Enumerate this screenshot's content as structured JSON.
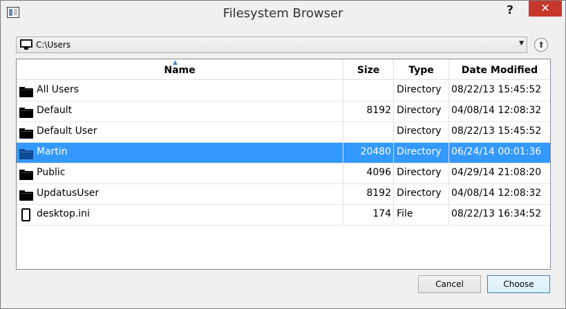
{
  "window": {
    "title": "Filesystem Browser",
    "help_label": "?",
    "close_label": "✕"
  },
  "path": {
    "value": "C:\\Users",
    "icon": "computer-icon"
  },
  "columns": {
    "name": "Name",
    "size": "Size",
    "type": "Type",
    "date": "Date Modified"
  },
  "rows": [
    {
      "name": "All Users",
      "size": "",
      "type": "Directory",
      "date": "08/22/13 15:45:52",
      "icon": "folder-icon",
      "selected": false
    },
    {
      "name": "Default",
      "size": "8192",
      "type": "Directory",
      "date": "04/08/14 12:08:32",
      "icon": "folder-icon",
      "selected": false
    },
    {
      "name": "Default User",
      "size": "",
      "type": "Directory",
      "date": "08/22/13 15:45:52",
      "icon": "folder-icon",
      "selected": false
    },
    {
      "name": "Martin",
      "size": "20480",
      "type": "Directory",
      "date": "06/24/14 00:01:36",
      "icon": "folder-icon",
      "selected": true
    },
    {
      "name": "Public",
      "size": "4096",
      "type": "Directory",
      "date": "04/29/14 21:08:20",
      "icon": "folder-icon",
      "selected": false
    },
    {
      "name": "UpdatusUser",
      "size": "8192",
      "type": "Directory",
      "date": "04/08/14 12:08:32",
      "icon": "folder-icon",
      "selected": false
    },
    {
      "name": "desktop.ini",
      "size": "174",
      "type": "File",
      "date": "08/22/13 16:34:52",
      "icon": "file-icon",
      "selected": false
    }
  ],
  "buttons": {
    "cancel": "Cancel",
    "choose": "Choose"
  },
  "colors": {
    "selection": "#3399ff",
    "close": "#c7372b"
  }
}
